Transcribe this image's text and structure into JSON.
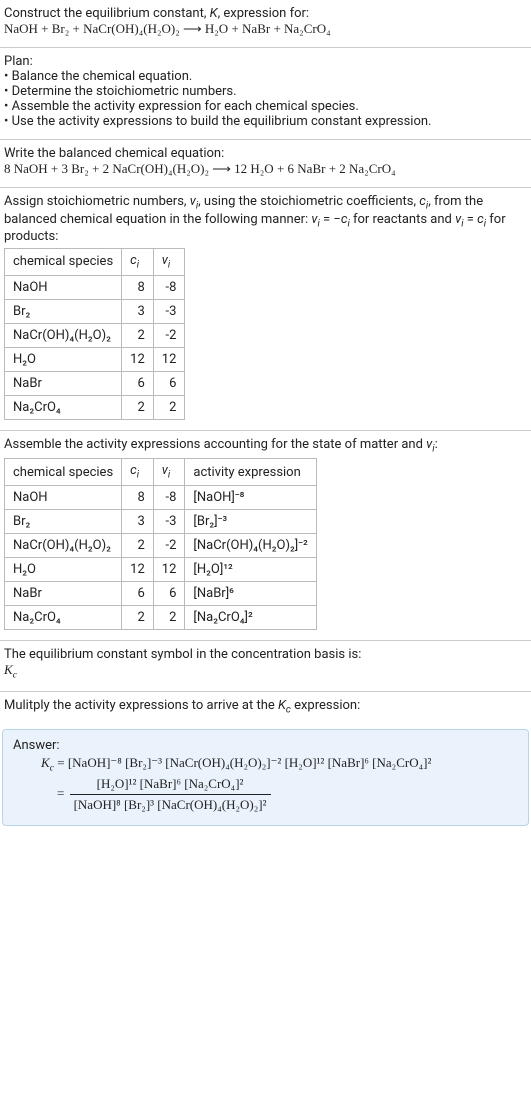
{
  "intro": {
    "line1": "Construct the equilibrium constant, K, expression for:",
    "equation": "NaOH + Br₂ + NaCr(OH)₄(H₂O)₂  ⟶  H₂O + NaBr + Na₂CrO₄"
  },
  "plan": {
    "heading": "Plan:",
    "items": [
      "Balance the chemical equation.",
      "Determine the stoichiometric numbers.",
      "Assemble the activity expression for each chemical species.",
      "Use the activity expressions to build the equilibrium constant expression."
    ]
  },
  "balanced": {
    "heading": "Write the balanced chemical equation:",
    "equation": "8 NaOH + 3 Br₂ + 2 NaCr(OH)₄(H₂O)₂  ⟶  12 H₂O + 6 NaBr + 2 Na₂CrO₄"
  },
  "stoich": {
    "text": "Assign stoichiometric numbers, νᵢ, using the stoichiometric coefficients, cᵢ, from the balanced chemical equation in the following manner: νᵢ = −cᵢ for reactants and νᵢ = cᵢ for products:",
    "headers": [
      "chemical species",
      "cᵢ",
      "νᵢ"
    ],
    "rows": [
      {
        "species": "NaOH",
        "c": "8",
        "v": "-8"
      },
      {
        "species": "Br₂",
        "c": "3",
        "v": "-3"
      },
      {
        "species": "NaCr(OH)₄(H₂O)₂",
        "c": "2",
        "v": "-2"
      },
      {
        "species": "H₂O",
        "c": "12",
        "v": "12"
      },
      {
        "species": "NaBr",
        "c": "6",
        "v": "6"
      },
      {
        "species": "Na₂CrO₄",
        "c": "2",
        "v": "2"
      }
    ]
  },
  "activity": {
    "text": "Assemble the activity expressions accounting for the state of matter and νᵢ:",
    "headers": [
      "chemical species",
      "cᵢ",
      "νᵢ",
      "activity expression"
    ],
    "rows": [
      {
        "species": "NaOH",
        "c": "8",
        "v": "-8",
        "expr": "[NaOH]⁻⁸"
      },
      {
        "species": "Br₂",
        "c": "3",
        "v": "-3",
        "expr": "[Br₂]⁻³"
      },
      {
        "species": "NaCr(OH)₄(H₂O)₂",
        "c": "2",
        "v": "-2",
        "expr": "[NaCr(OH)₄(H₂O)₂]⁻²"
      },
      {
        "species": "H₂O",
        "c": "12",
        "v": "12",
        "expr": "[H₂O]¹²"
      },
      {
        "species": "NaBr",
        "c": "6",
        "v": "6",
        "expr": "[NaBr]⁶"
      },
      {
        "species": "Na₂CrO₄",
        "c": "2",
        "v": "2",
        "expr": "[Na₂CrO₄]²"
      }
    ]
  },
  "kc_symbol": {
    "text": "The equilibrium constant symbol in the concentration basis is:",
    "symbol": "K_c"
  },
  "multiply": {
    "text": "Mulitply the activity expressions to arrive at the K_c expression:"
  },
  "answer": {
    "heading": "Answer:",
    "line1": "K_c = [NaOH]⁻⁸ [Br₂]⁻³ [NaCr(OH)₄(H₂O)₂]⁻² [H₂O]¹² [NaBr]⁶ [Na₂CrO₄]²",
    "frac_num": "[H₂O]¹² [NaBr]⁶ [Na₂CrO₄]²",
    "frac_den": "[NaOH]⁸ [Br₂]³ [NaCr(OH)₄(H₂O)₂]²"
  }
}
